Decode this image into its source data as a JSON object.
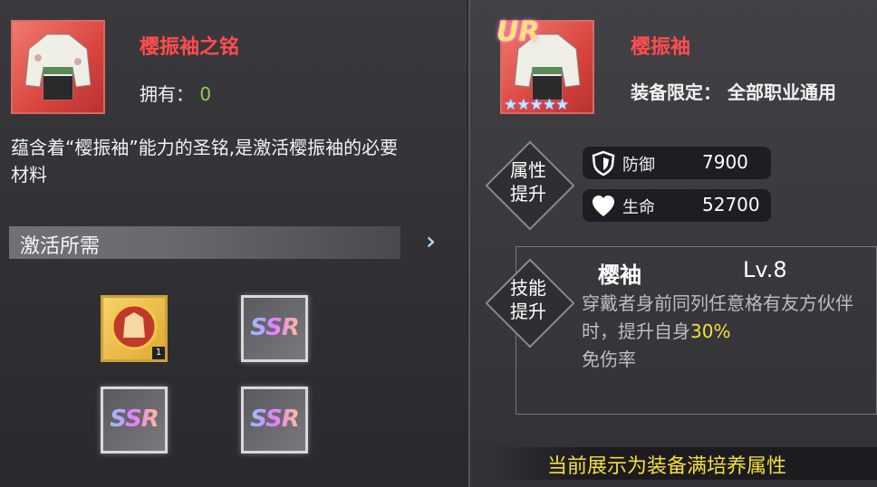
{
  "left": {
    "item_name": "樱振袖之铭",
    "owned_label": "拥有：",
    "owned_count": "0",
    "description": "蕴含着“樱振袖”能力的圣铭,是激活樱振袖的必要材料",
    "section_title": "激活所需",
    "materials": [
      {
        "type": "gold",
        "count": "1"
      },
      {
        "type": "ssr",
        "label": "SSR"
      },
      {
        "type": "ssr",
        "label": "SSR"
      },
      {
        "type": "ssr",
        "label": "SSR"
      }
    ]
  },
  "right": {
    "rarity": "UR",
    "stars": "★★★★★",
    "item_name": "樱振袖",
    "restrict_label": "装备限定：",
    "restrict_value": "全部职业通用",
    "attr_section": "属性提升",
    "stats": [
      {
        "icon": "shield-icon",
        "label": "防御",
        "value": "7900"
      },
      {
        "icon": "heart-icon",
        "label": "生命",
        "value": "52700"
      }
    ],
    "skill_section": "技能提升",
    "skill_name": "樱袖",
    "skill_level": "Lv.8",
    "skill_desc_pre": "穿戴者身前同列任意格有友方伙伴时，提升自身",
    "skill_desc_highlight": "30%",
    "skill_desc_post": "免伤率",
    "footer_note": "当前展示为装备满培养属性"
  },
  "colors": {
    "name_red": "#ff4d4d",
    "owned_green": "#8fd14f",
    "highlight_yellow": "#f3e03a"
  }
}
